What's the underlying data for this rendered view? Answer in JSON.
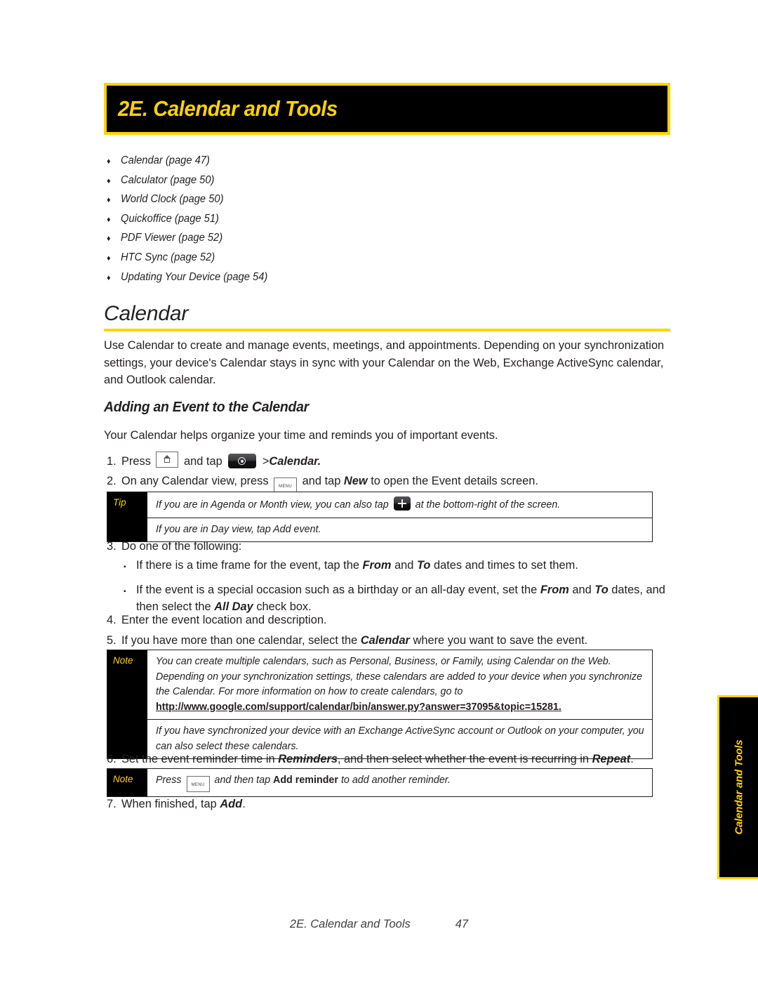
{
  "chapter": {
    "title": "2E. Calendar and Tools"
  },
  "toc": {
    "bullet": "♦",
    "items": [
      {
        "label": "Calendar (page 47)"
      },
      {
        "label": "Calculator (page 50)"
      },
      {
        "label": "World Clock (page 50)"
      },
      {
        "label": "Quickoffice (page 51)"
      },
      {
        "label": "PDF Viewer (page 52)"
      },
      {
        "label": "HTC Sync (page 52)"
      },
      {
        "label": "Updating Your Device (page 54)"
      }
    ]
  },
  "section": {
    "heading": "Calendar",
    "intro": "Use Calendar to create and manage events, meetings, and appointments. Depending on your synchronization settings, your device's Calendar stays in sync with your Calendar on the Web, Exchange ActiveSync calendar, and Outlook calendar.",
    "subheading": "Adding an Event to the Calendar",
    "lead": "Your Calendar helps organize your time and reminds you of important events."
  },
  "steps": {
    "s1": {
      "num": "1.",
      "a": "Press",
      "b": "and tap",
      "c": ">",
      "d": "Calendar."
    },
    "s2": {
      "num": "2.",
      "a": "On any Calendar view, press",
      "b": "and tap",
      "c": "New",
      "d": "to open the Event details screen."
    },
    "s3": {
      "num": "3.",
      "text": "Do one of the following:"
    },
    "s4": {
      "num": "4.",
      "text": "Enter the event location and description."
    },
    "s5": {
      "num": "5.",
      "a": "If you have more than one calendar, select the",
      "b": "Calendar",
      "c": "where you want to save the event."
    },
    "s6": {
      "num": "6.",
      "a": "Set the event reminder time in",
      "b": "Reminders",
      "c": ", and then select whether the event is recurring in",
      "d": "Repeat",
      "e": "."
    },
    "s7": {
      "num": "7.",
      "a": "When finished, tap",
      "b": "Add",
      "c": "."
    }
  },
  "sublist": {
    "bullet": "▪",
    "item1": {
      "a": "If there is a time frame for the event, tap the",
      "b": "From",
      "c": "and",
      "d": "To",
      "e": "dates and times to set them."
    },
    "item2": {
      "a": "If the event is a special occasion such as a birthday or an all-day event, set the",
      "b": "From",
      "c": "and",
      "d": "To",
      "e": "dates, and then select the",
      "f": "All Day",
      "g": "check box."
    }
  },
  "tip_box": {
    "label": "Tip",
    "row1_a": "If you are in Agenda or Month view, you can also tap",
    "row1_b": "at the bottom-right of the screen.",
    "row2": "If you are in Day view, tap Add event."
  },
  "note_box": {
    "label": "Note",
    "row1_a": "You can create multiple calendars, such as Personal, Business, or Family, using Calendar on the Web. Depending on your synchronization settings, these calendars are added to your device when you synchronize the Calendar. For more information on how to create calendars, go to",
    "row1_url": "http://www.google.com/support/calendar/bin/answer.py?answer=37095&topic=15281.",
    "row2": "If you have synchronized your device with an Exchange ActiveSync account or Outlook on your computer, you can also select these calendars."
  },
  "note_box2": {
    "label": "Note",
    "a": "Press",
    "b": "and then tap",
    "c": "Add reminder",
    "d": "to add another reminder."
  },
  "side_tab": {
    "text": "Calendar and Tools"
  },
  "footer": {
    "title": "2E. Calendar and Tools",
    "page": "47"
  },
  "icons": {
    "home_key": "home-key-icon",
    "menu_key": "menu-key-icon",
    "launcher": "app-launcher-icon",
    "plus": "plus-button-icon"
  },
  "colors": {
    "accent_yellow": "#FFD400",
    "ink": "#231f20"
  }
}
